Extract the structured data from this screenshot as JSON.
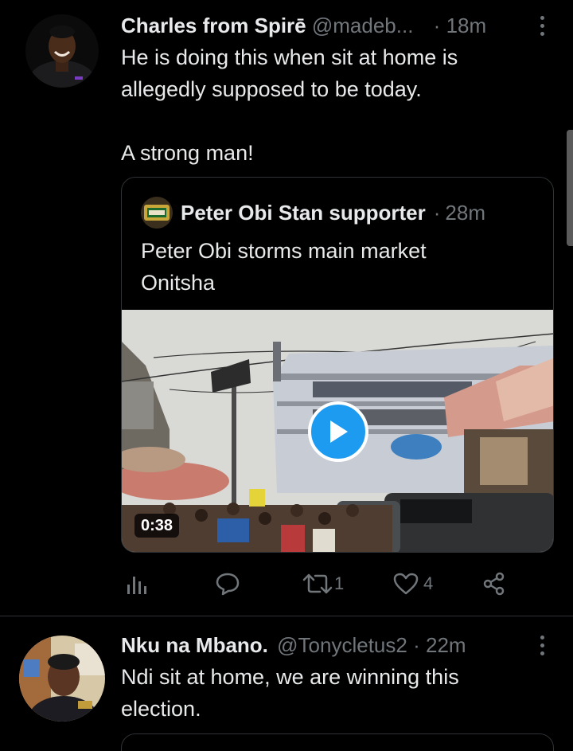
{
  "tweets": [
    {
      "name": "Charles from Spirē",
      "handle": "@madeb...",
      "separator": "·",
      "time": "18m",
      "text": "He is doing this when sit at home is\nallegedly supposed to be today.\n\nA strong man!",
      "quote": {
        "name": "Peter Obi Stan supporter",
        "separator": "·",
        "time": "28m",
        "text": "Peter Obi storms main market\nOnitsha",
        "video": {
          "duration": "0:38"
        }
      },
      "actions": {
        "analytics_icon": "bar-chart-icon",
        "reply_icon": "comment-icon",
        "retweet_icon": "retweet-icon",
        "retweet_count": "1",
        "like_icon": "heart-icon",
        "like_count": "4",
        "share_icon": "share-icon"
      }
    },
    {
      "name": "Nku na Mbano.",
      "handle": "@Tonycletus2",
      "separator": "·",
      "time": "22m",
      "text": "Ndi sit at home, we are winning this\nelection."
    }
  ],
  "colors": {
    "background": "#000000",
    "text_primary": "#e7e9ea",
    "text_secondary": "#71767b",
    "border": "#2f3336",
    "accent": "#1d9bf0"
  }
}
